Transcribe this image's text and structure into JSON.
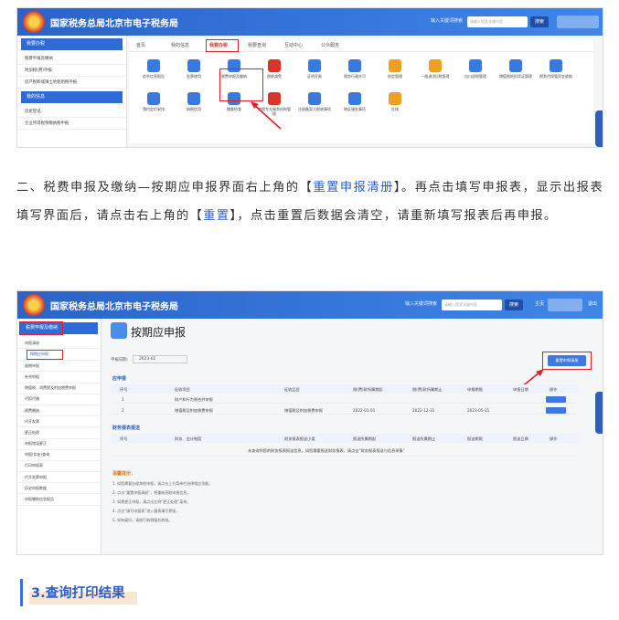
{
  "site_title": "国家税务总局北京市电子税务局",
  "header": {
    "search_hint": "输入关键词搜索",
    "search_placeholder": "请输入搜索关键内容",
    "search_button": "搜索",
    "link_home": "主页",
    "link_exit": "退出"
  },
  "shot1": {
    "sidebar": [
      "我要办税",
      "税费申报及缴纳",
      "附加税(费)申报",
      "房产税和城镇土地使用税申报",
      "我的信息",
      "房屋登记",
      "企业所得税预缴纳税申报"
    ],
    "tabs": [
      "首页",
      "我的信息",
      "我要办税",
      "我要查询",
      "互动中心",
      "公众服务"
    ],
    "icons_row1": [
      "综合信息报告",
      "发票使用",
      "税费申报及缴纳",
      "税收减免",
      "证明开具",
      "税务行政许可",
      "核定管理",
      "一般退(抵)税管理",
      "出口退税管理",
      "增值税抵扣凭证管理",
      "税务代保管资金收取"
    ],
    "icons_row2": [
      "预约定价安排",
      "纳税信用",
      "稽查检查",
      "涉税专业服务机构管理",
      "注册备案与税收事项",
      "跨区服务事项",
      "社保"
    ]
  },
  "paragraph": {
    "p1": "二、税费申报及缴纳—按期应申报界面右上角的【",
    "b1": "重置申报清册",
    "p2": "】。再点击填写申报表，显示出报表填写界面后，请点击右上角的【",
    "b2": "重置",
    "p3": "】，点击重置后数据会清空，请重新填写报表后再申报。"
  },
  "shot2": {
    "sidebar_head": "税费申报及缴纳",
    "sidebar_items": [
      "申报清册",
      "按期应申报",
      "逾期申报",
      "补充申报",
      "增值税、消费税及附加税费申报",
      "代扣代缴",
      "税费缴纳",
      "代开发票",
      "更正处理",
      "申报错误更正",
      "申报(实名)查询",
      "打印申报表",
      "代开发票申报",
      "历史申报数据",
      "申报辅助信息报告"
    ],
    "page_title": "按期应申报",
    "period_label": "申报日期:",
    "period_value": "2023-02",
    "reset_button": "重置申报清册",
    "section1": "应申报",
    "table1_headers": [
      "序号",
      "征收项目",
      "征收品目",
      "税(费)款所属期起",
      "税(费)款所属期止",
      "申报期限",
      "申报日期",
      "操作"
    ],
    "rows": [
      {
        "no": "1",
        "item": "财产和行为税合并申报",
        "sub": "",
        "start": "",
        "end": "",
        "deadline": "",
        "date": ""
      },
      {
        "no": "2",
        "item": "增值税及附加税费申报",
        "sub": "增值税及附加税费申报",
        "start": "2022-01-01",
        "end": "2022-12-31",
        "deadline": "2023-05-31",
        "date": ""
      }
    ],
    "section2": "财务报表报送",
    "table2_headers": [
      "序号",
      "财务、会计制度",
      "财务报表报送小类",
      "报送所属期起",
      "报送所属期止",
      "报送期限",
      "报送日期",
      "操作"
    ],
    "table2_empty": "未查询到您的财务报表报送信息，如您需要报送财务报表，请点击“财务报表报送与信息采集”",
    "notes_title": "温馨提示：",
    "notes": [
      "1. 如您需要办理其他申报，请点击上方菜单栏选择相应功能。",
      "2. 点击“重置申报清册”，将重新获取申报信息。",
      "3. 如需更正申报，请点击左侧“更正处理”菜单。",
      "4. 点击“填写申报表”进入报表填写界面。",
      "5. 如有疑问，请拨打纳税服务热线。"
    ]
  },
  "section_heading": "3.查询打印结果"
}
